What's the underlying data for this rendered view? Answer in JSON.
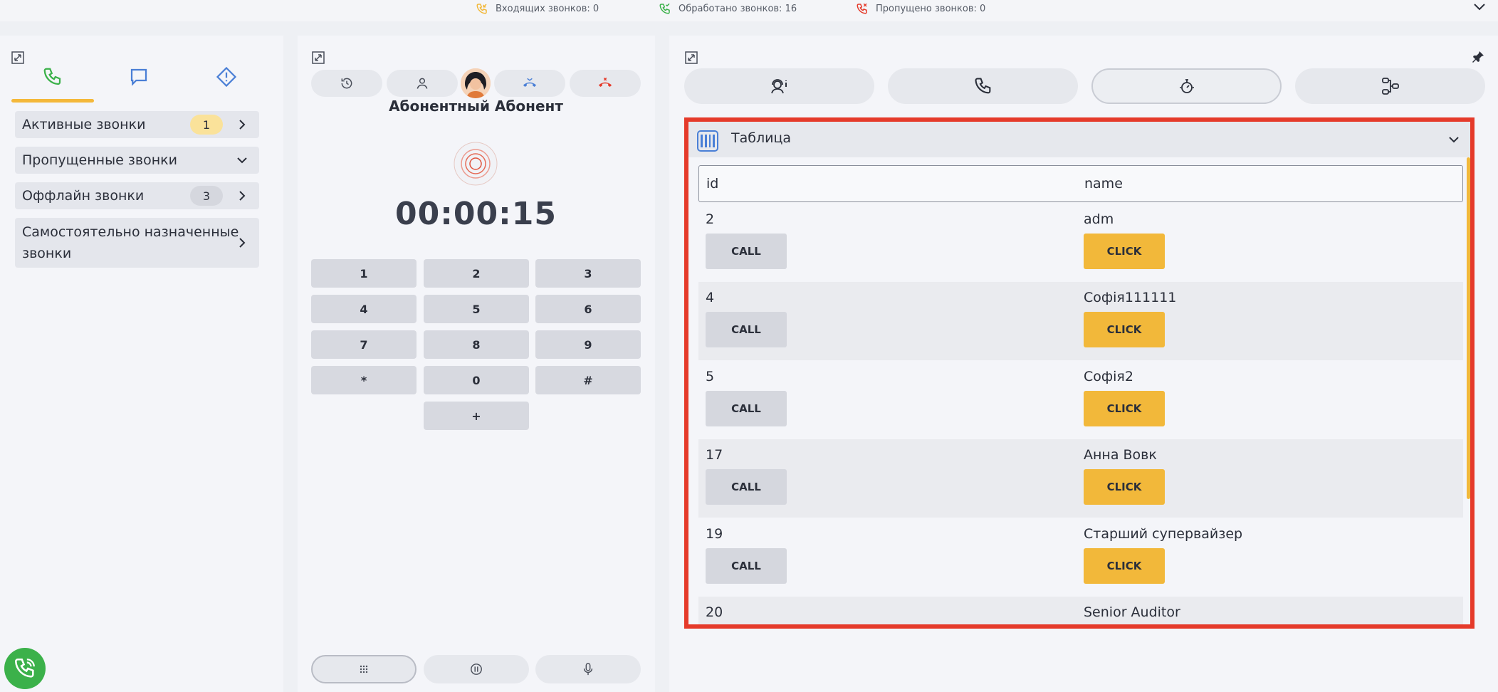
{
  "topbar": {
    "incoming": "Входящих звонков: 0",
    "processed": "Обработано звонков: 16",
    "missed": "Пропущено звонков: 0"
  },
  "left": {
    "rows": [
      {
        "label": "Активные звонки",
        "badge": "1"
      },
      {
        "label": "Пропущенные звонки"
      },
      {
        "label": "Оффлайн звонки",
        "badge": "3"
      },
      {
        "label_line1": "Самостоятельно назначенные",
        "label_line2": "звонки"
      }
    ]
  },
  "middle": {
    "contact": "Абонентный Абонент",
    "timer": "00:00:15",
    "keys": [
      "1",
      "2",
      "3",
      "4",
      "5",
      "6",
      "7",
      "8",
      "9",
      "*",
      "0",
      "#",
      "+"
    ]
  },
  "table": {
    "title": "Таблица",
    "columns": [
      "id",
      "name"
    ],
    "rows": [
      {
        "id": "2",
        "name": "adm"
      },
      {
        "id": "4",
        "name": "Софія111111"
      },
      {
        "id": "5",
        "name": "Софія2"
      },
      {
        "id": "17",
        "name": "Анна Вовк"
      },
      {
        "id": "19",
        "name": "Старший супервайзер"
      },
      {
        "id": "20",
        "name": "Senior Auditor"
      }
    ],
    "call_label": "CALL",
    "click_label": "CLICK"
  },
  "colors": {
    "accent": "#f2b83a",
    "highlight": "#e53a2a",
    "phone_green": "#3bb14a",
    "link_blue": "#4a7fd6"
  }
}
